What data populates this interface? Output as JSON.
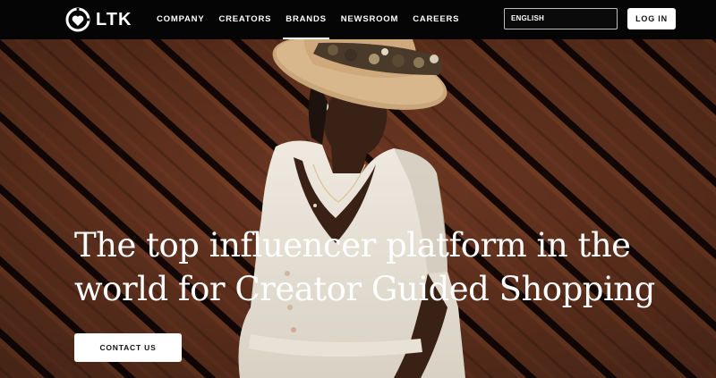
{
  "brand": {
    "name": "LTK"
  },
  "nav": {
    "items": [
      {
        "label": "COMPANY"
      },
      {
        "label": "CREATORS"
      },
      {
        "label": "BRANDS"
      },
      {
        "label": "NEWSROOM"
      },
      {
        "label": "CAREERS"
      }
    ],
    "active": "BRANDS"
  },
  "language": {
    "selected": "ENGLISH"
  },
  "login": {
    "label": "LOG IN"
  },
  "hero": {
    "headline_line1": "The top influencer platform in the",
    "headline_line2": "world for Creator Guided Shopping",
    "cta_label": "CONTACT US"
  },
  "colors": {
    "topbar": "#050505",
    "hero_wood": "#6b3520",
    "wood_gap": "#120806",
    "text": "#ffffff"
  }
}
